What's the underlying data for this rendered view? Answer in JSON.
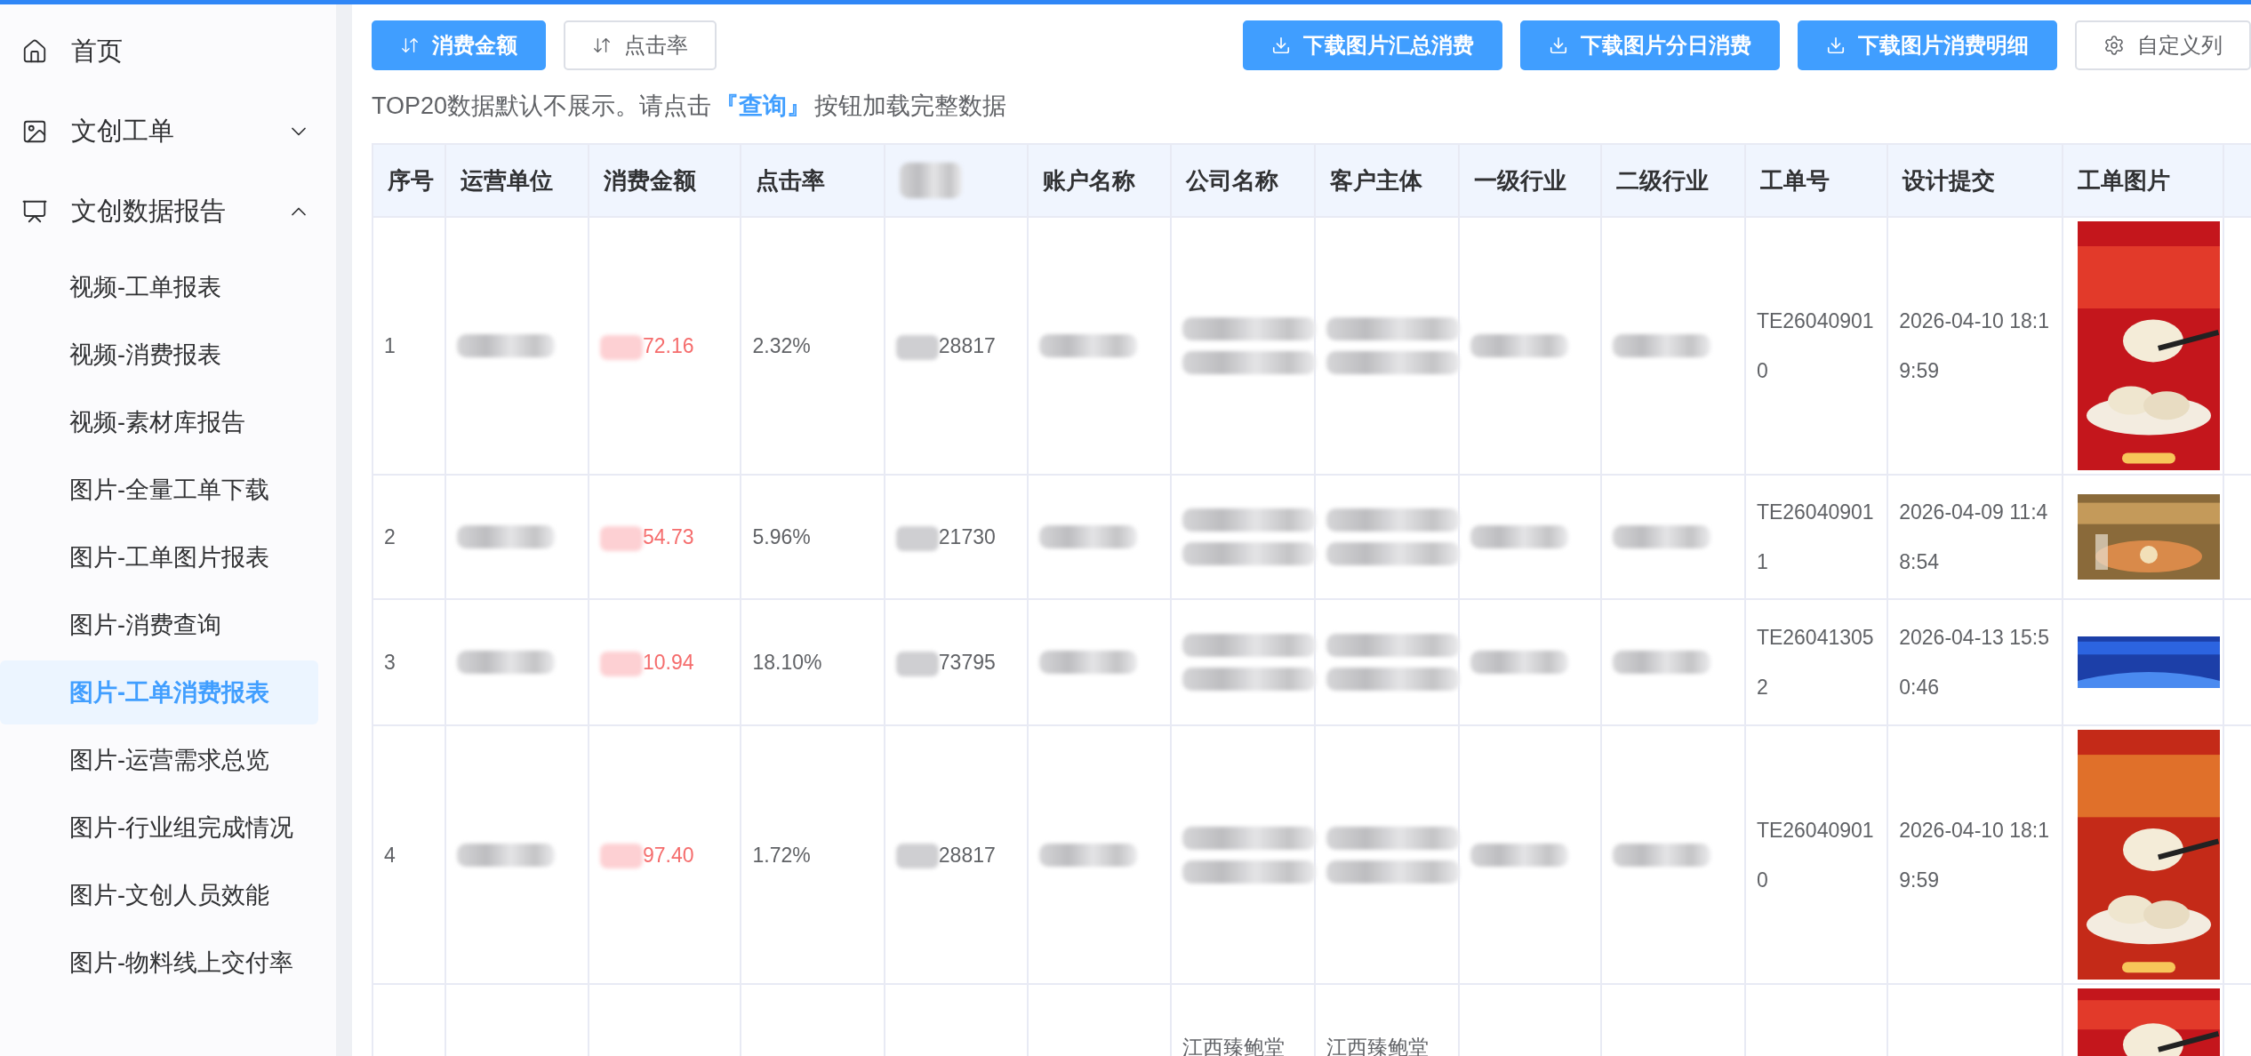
{
  "sidebar": {
    "items": [
      {
        "label": "首页"
      },
      {
        "label": "文创工单",
        "expanded": false
      },
      {
        "label": "文创数据报告",
        "expanded": true,
        "children": [
          {
            "label": "视频-工单报表",
            "selected": false
          },
          {
            "label": "视频-消费报表",
            "selected": false
          },
          {
            "label": "视频-素材库报告",
            "selected": false
          },
          {
            "label": "图片-全量工单下载",
            "selected": false
          },
          {
            "label": "图片-工单图片报表",
            "selected": false
          },
          {
            "label": "图片-消费查询",
            "selected": false
          },
          {
            "label": "图片-工单消费报表",
            "selected": true
          },
          {
            "label": "图片-运营需求总览",
            "selected": false
          },
          {
            "label": "图片-行业组完成情况",
            "selected": false
          },
          {
            "label": "图片-文创人员效能",
            "selected": false
          },
          {
            "label": "图片-物料线上交付率",
            "selected": false
          }
        ]
      }
    ]
  },
  "toolbar": {
    "sort_buttons": [
      {
        "label": "消费金额",
        "selected": true
      },
      {
        "label": "点击率",
        "selected": false
      }
    ],
    "action_buttons": [
      {
        "label": "下载图片汇总消费",
        "kind": "download"
      },
      {
        "label": "下载图片分日消费",
        "kind": "download"
      },
      {
        "label": "下载图片消费明细",
        "kind": "download"
      },
      {
        "label": "自定义列",
        "kind": "settings"
      }
    ]
  },
  "notice": {
    "before": "TOP20数据默认不展示。请点击",
    "link": "『查询』",
    "after": "按钮加载完整数据"
  },
  "table": {
    "columns": [
      {
        "label": "序号"
      },
      {
        "label": "运营单位"
      },
      {
        "label": "消费金额"
      },
      {
        "label": "点击率"
      },
      {
        "redacted": true
      },
      {
        "label": "账户名称"
      },
      {
        "label": "公司名称"
      },
      {
        "label": "客户主体"
      },
      {
        "label": "一级行业"
      },
      {
        "label": "二级行业"
      },
      {
        "label": "工单号"
      },
      {
        "label": "设计提交"
      },
      {
        "label": "工单图片"
      }
    ],
    "rows": [
      {
        "cells": [
          {
            "kind": "plain",
            "text": "1"
          },
          {
            "kind": "blurred"
          },
          {
            "kind": "amount",
            "text": "72.16",
            "redacted_prefix": true
          },
          {
            "kind": "plain",
            "text": "2.32%"
          },
          {
            "kind": "plain",
            "text": "28817",
            "redacted_prefix": true
          },
          {
            "kind": "blurred"
          },
          {
            "kind": "blurred"
          },
          {
            "kind": "blurred"
          },
          {
            "kind": "blurred"
          },
          {
            "kind": "blurred"
          },
          {
            "kind": "plain",
            "text": "TE260409010"
          },
          {
            "kind": "plain",
            "text": "2026-04-10 18:19:59"
          },
          {
            "kind": "picture"
          }
        ]
      },
      {
        "cells": [
          {
            "kind": "plain",
            "text": "2"
          },
          {
            "kind": "blurred"
          },
          {
            "kind": "amount",
            "text": "54.73",
            "redacted_prefix": true
          },
          {
            "kind": "plain",
            "text": "5.96%"
          },
          {
            "kind": "plain",
            "text": "21730",
            "redacted_prefix": true
          },
          {
            "kind": "blurred"
          },
          {
            "kind": "blurred"
          },
          {
            "kind": "blurred"
          },
          {
            "kind": "blurred"
          },
          {
            "kind": "blurred"
          },
          {
            "kind": "plain",
            "text": "TE260409011"
          },
          {
            "kind": "plain",
            "text": "2026-04-09 11:48:54"
          },
          {
            "kind": "picture"
          }
        ]
      },
      {
        "cells": [
          {
            "kind": "plain",
            "text": "3"
          },
          {
            "kind": "blurred"
          },
          {
            "kind": "amount",
            "text": "10.94",
            "redacted_prefix": true
          },
          {
            "kind": "plain",
            "text": "18.10%"
          },
          {
            "kind": "plain",
            "text": "73795",
            "redacted_prefix": true
          },
          {
            "kind": "blurred"
          },
          {
            "kind": "blurred"
          },
          {
            "kind": "blurred"
          },
          {
            "kind": "blurred"
          },
          {
            "kind": "blurred"
          },
          {
            "kind": "plain",
            "text": "TE260413052"
          },
          {
            "kind": "plain",
            "text": "2026-04-13 15:50:46"
          },
          {
            "kind": "picture"
          }
        ]
      },
      {
        "cells": [
          {
            "kind": "plain",
            "text": "4"
          },
          {
            "kind": "blurred"
          },
          {
            "kind": "amount",
            "text": "97.40",
            "redacted_prefix": true
          },
          {
            "kind": "plain",
            "text": "1.72%"
          },
          {
            "kind": "plain",
            "text": "28817",
            "redacted_prefix": true
          },
          {
            "kind": "blurred"
          },
          {
            "kind": "blurred"
          },
          {
            "kind": "blurred"
          },
          {
            "kind": "blurred"
          },
          {
            "kind": "blurred"
          },
          {
            "kind": "plain",
            "text": "TE260409010"
          },
          {
            "kind": "plain",
            "text": "2026-04-10 18:19:59"
          },
          {
            "kind": "picture"
          }
        ]
      },
      {
        "cells": [
          {
            "kind": "empty"
          },
          {
            "kind": "empty"
          },
          {
            "kind": "empty"
          },
          {
            "kind": "empty"
          },
          {
            "kind": "empty"
          },
          {
            "kind": "empty"
          },
          {
            "kind": "plain",
            "text": "江西臻鲍堂"
          },
          {
            "kind": "plain",
            "text": "江西臻鲍堂"
          },
          {
            "kind": "empty"
          },
          {
            "kind": "empty"
          },
          {
            "kind": "empty"
          },
          {
            "kind": "empty"
          },
          {
            "kind": "picture"
          }
        ]
      }
    ]
  }
}
